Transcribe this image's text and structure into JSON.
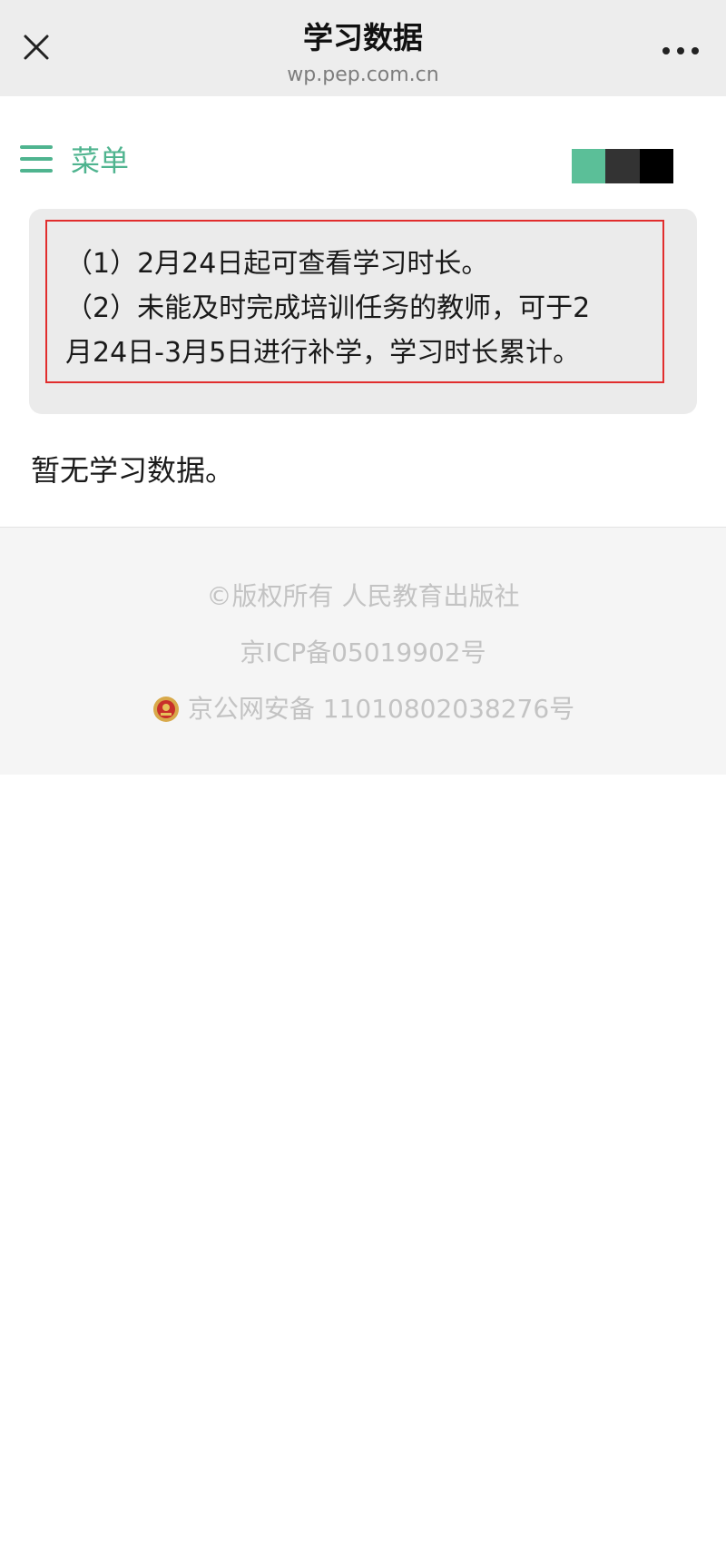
{
  "header": {
    "title": "学习数据",
    "url": "wp.pep.com.cn",
    "close_icon": "close-icon",
    "more_icon": "more-icon"
  },
  "menu": {
    "icon": "hamburger-icon",
    "label": "菜单"
  },
  "color_strip": {
    "colors": [
      "#5bbf98",
      "#333333",
      "#000000"
    ]
  },
  "notice": {
    "lines": [
      "（1）2月24日起可查看学习时长。",
      "（2）未能及时完成培训任务的教师，可于2",
      "月24日-3月5日进行补学，学习时长累计。"
    ],
    "border_color": "#e12d2d"
  },
  "content": {
    "empty_message": "暂无学习数据。"
  },
  "footer": {
    "copyright": "©版权所有  人民教育出版社",
    "icp": "京ICP备05019902号",
    "police_icon": "police-emblem-icon",
    "police": "京公网安备 11010802038276号"
  },
  "colors": {
    "accent": "#4fb48f",
    "header_bg": "#ededed",
    "footer_bg": "#f5f5f5",
    "footer_text": "#c3c3c3"
  }
}
